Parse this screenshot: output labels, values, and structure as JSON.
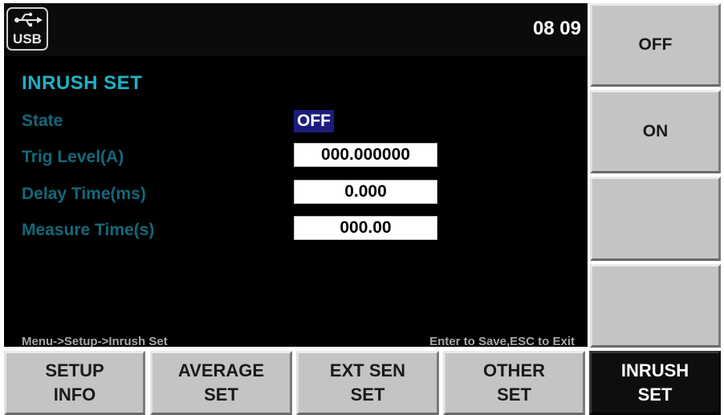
{
  "status_bar": {
    "usb_label": "USB",
    "time": "08 09"
  },
  "panel": {
    "title": "INRUSH SET",
    "params": [
      {
        "label": "State",
        "value": "OFF"
      },
      {
        "label": "Trig Level(A)",
        "value": "000.000000"
      },
      {
        "label": "Delay Time(ms)",
        "value": "0.000"
      },
      {
        "label": "Measure Time(s)",
        "value": "000.00"
      }
    ],
    "breadcrumb": "Menu->Setup->Inrush Set",
    "hint": "Enter to Save,ESC to Exit"
  },
  "side_softkeys": [
    {
      "label": "OFF"
    },
    {
      "label": "ON"
    },
    {
      "label": ""
    },
    {
      "label": ""
    }
  ],
  "bottom_softkeys": [
    {
      "line1": "SETUP",
      "line2": "INFO"
    },
    {
      "line1": "AVERAGE",
      "line2": "SET"
    },
    {
      "line1": "EXT SEN",
      "line2": "SET"
    },
    {
      "line1": "OTHER",
      "line2": "SET"
    },
    {
      "line1": "INRUSH",
      "line2": "SET",
      "active": true
    }
  ],
  "colors": {
    "title": "#1fb1c4",
    "param_label": "#14687a",
    "selected_highlight": "#1c1c7c",
    "softkey": "#c4c4c4",
    "softkey_active": "#0e0e0e"
  },
  "icons": [
    "usb-icon"
  ]
}
